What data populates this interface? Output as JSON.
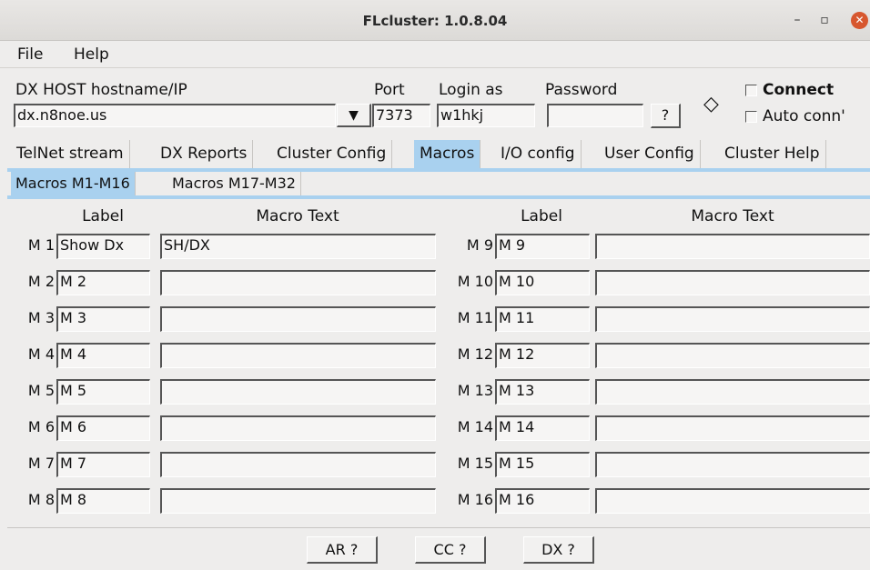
{
  "window": {
    "title": "FLcluster: 1.0.8.04",
    "minimize": "–",
    "maximize": "▫",
    "close": "✕"
  },
  "menu": [
    "File",
    "Help"
  ],
  "connection": {
    "host_label": "DX HOST hostname/IP",
    "host_value": "dx.n8noe.us",
    "port_label": "Port",
    "port_value": "7373",
    "login_label": "Login as",
    "login_value": "w1hkj",
    "password_label": "Password",
    "password_value": "",
    "help_button": "?",
    "status_symbol": "◇",
    "connect_label": "Connect",
    "autoconn_label": "Auto conn'"
  },
  "tabs": [
    "TelNet stream",
    "DX Reports",
    "Cluster Config",
    "Macros",
    "I/O config",
    "User Config",
    "Cluster Help"
  ],
  "active_tab": "Macros",
  "subtabs": [
    "Macros M1-M16",
    "Macros M17-M32"
  ],
  "headers": {
    "label": "Label",
    "macro_text": "Macro Text"
  },
  "left_macros": [
    {
      "id": "M 1",
      "label": "Show Dx",
      "text": "SH/DX"
    },
    {
      "id": "M 2",
      "label": "M 2",
      "text": ""
    },
    {
      "id": "M 3",
      "label": "M 3",
      "text": ""
    },
    {
      "id": "M 4",
      "label": "M 4",
      "text": ""
    },
    {
      "id": "M 5",
      "label": "M 5",
      "text": ""
    },
    {
      "id": "M 6",
      "label": "M 6",
      "text": ""
    },
    {
      "id": "M 7",
      "label": "M 7",
      "text": ""
    },
    {
      "id": "M 8",
      "label": "M 8",
      "text": ""
    }
  ],
  "right_macros": [
    {
      "id": "M 9",
      "label": "M 9",
      "text": ""
    },
    {
      "id": "M 10",
      "label": "M 10",
      "text": ""
    },
    {
      "id": "M 11",
      "label": "M 11",
      "text": ""
    },
    {
      "id": "M 12",
      "label": "M 12",
      "text": ""
    },
    {
      "id": "M 13",
      "label": "M 13",
      "text": ""
    },
    {
      "id": "M 14",
      "label": "M 14",
      "text": ""
    },
    {
      "id": "M 15",
      "label": "M 15",
      "text": ""
    },
    {
      "id": "M 16",
      "label": "M 16",
      "text": ""
    }
  ],
  "bottom_buttons": [
    "AR ?",
    "CC ?",
    "DX ?"
  ]
}
